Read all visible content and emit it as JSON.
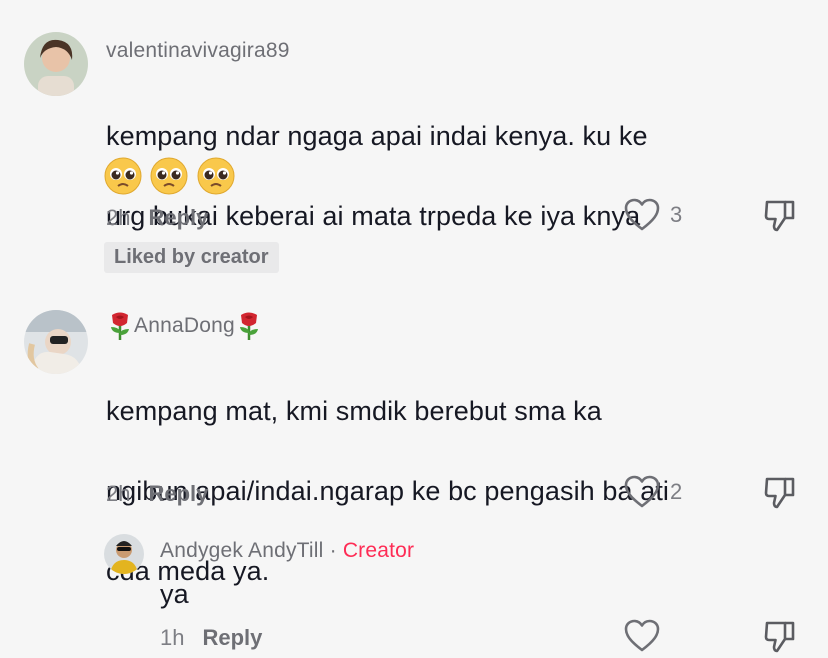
{
  "comments": [
    {
      "username": "valentinavivagira89",
      "text_line1": "kempang ndar ngaga apai indai kenya. ku ke",
      "text_line2": "urg bukai keberai ai mata trpeda ke iya knya",
      "emoji": [
        "pleading-face-emoji",
        "pleading-face-emoji",
        "pleading-face-emoji"
      ],
      "time": "2h",
      "reply_label": "Reply",
      "likes": "3",
      "badge": "Liked by creator"
    },
    {
      "username": "AnnaDong",
      "username_decoration": "rose-emoji",
      "text_line1": "kempang mat, kmi smdik berebut sma ka",
      "text_line2": "ngibun apai/indai.ngarap ke bc pengasih ba ati",
      "text_line3": "cda meda ya.",
      "time": "2h",
      "reply_label": "Reply",
      "likes": "2"
    }
  ],
  "reply": {
    "username": "Andygek AndyTill",
    "separator": "·",
    "creator_label": "Creator",
    "text": "ya",
    "time": "1h",
    "reply_label": "Reply",
    "likes": ""
  },
  "colors": {
    "background": "#f6f6f6",
    "creator_accent": "#fe2c55",
    "muted_text": "#7d7e84"
  }
}
